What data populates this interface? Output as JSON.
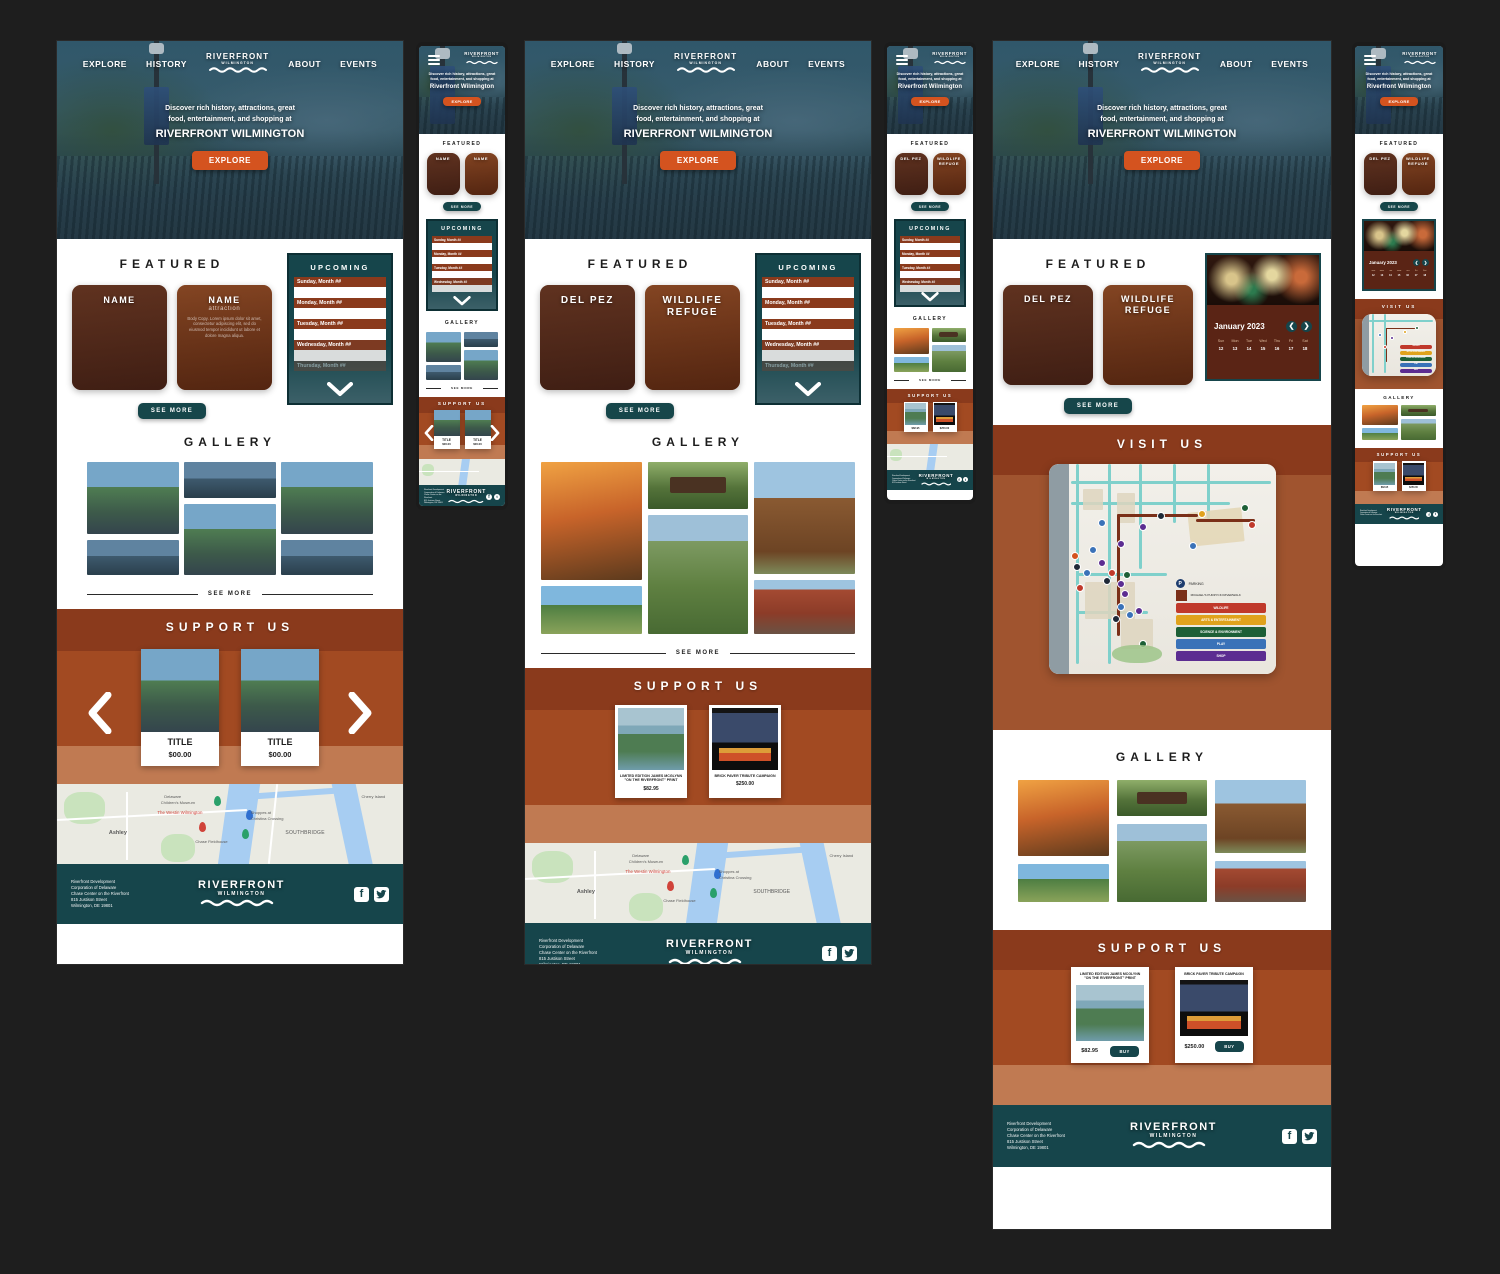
{
  "page": {
    "background": "#1e1e1e",
    "title": "Riverfront Wilmington — Responsive Web Mockups"
  },
  "brand": {
    "name_line1": "RIVERFRONT",
    "name_line2": "WILMINGTON",
    "accent_orange": "#d4531f",
    "accent_teal": "#16454b",
    "accent_rust": "#8a3a1c",
    "accent_clay": "#c07a52"
  },
  "nav": {
    "items": [
      {
        "label": "EXPLORE"
      },
      {
        "label": "HISTORY"
      },
      {
        "label": "ABOUT"
      },
      {
        "label": "EVENTS"
      }
    ],
    "menu_icon": "hamburger-icon"
  },
  "hero": {
    "sub_line1": "Discover rich history, attractions, great",
    "sub_line2": "food, entertainment, and shopping at",
    "headline": "RIVERFRONT WILMINGTON",
    "headline_mobile": "Riverfront Wilmington",
    "cta": "EXPLORE"
  },
  "featured": {
    "title": "FEATURED",
    "see_more": "SEE MORE",
    "placeholder_cards": [
      {
        "name": "NAME",
        "sub": "",
        "text": ""
      },
      {
        "name": "NAME",
        "sub": "attraction",
        "text": "Body Copy. Lorem ipsum dolor sit amet, consectetur adipiscing elit, sed do eiusmod tempor incididunt ut labore et dolore magna aliqua."
      }
    ],
    "real_cards": [
      {
        "name": "DEL PEZ",
        "sub": "",
        "text": ""
      },
      {
        "name": "WILDLIFE REFUGE",
        "sub": "",
        "text": ""
      }
    ]
  },
  "upcoming": {
    "title": "UPCOMING",
    "events": [
      {
        "label": "Sunday, Month ##"
      },
      {
        "label": "Monday, Month ##"
      },
      {
        "label": "Tuesday, Month ##"
      },
      {
        "label": "Wednesday, Month ##"
      },
      {
        "label": "Thursday, Month ##"
      }
    ],
    "scroll_icon": "chevron-down-icon"
  },
  "calendar": {
    "month_label": "January 2023",
    "prev_icon": "chevron-left-icon",
    "next_icon": "chevron-right-icon",
    "day_headers": [
      "Sun",
      "Mon",
      "Tue",
      "Wed",
      "Thu",
      "Fri",
      "Sat"
    ],
    "day_numbers": [
      "12",
      "13",
      "14",
      "15",
      "16",
      "17",
      "18"
    ]
  },
  "gallery": {
    "title": "GALLERY",
    "see_more": "SEE MORE",
    "photos": [
      {
        "caption": "rowers-at-sunset"
      },
      {
        "caption": "wildlife-refuge-sign"
      },
      {
        "caption": "riverwalk-timber-tower"
      },
      {
        "caption": "aerial-riverfront-boardwalk"
      },
      {
        "caption": "marsh-and-skyline"
      },
      {
        "caption": "riverfront-market-building"
      }
    ]
  },
  "visit_us": {
    "title": "VISIT US",
    "legend": [
      {
        "label": "PARKING",
        "color": "#1d3c6e",
        "type": "icon"
      },
      {
        "label": "MICHAEL'S PURZYCKI RIVERWALK",
        "color": "#7a2f18",
        "type": "swatch"
      },
      {
        "label": "WILDLIFE",
        "color": "#c0392b",
        "type": "bar"
      },
      {
        "label": "ARTS & ENTERTAINMENT",
        "color": "#e0a21c",
        "type": "bar"
      },
      {
        "label": "SCIENCE & ENVIRONMENT",
        "color": "#1d5f36",
        "type": "bar"
      },
      {
        "label": "PLAY",
        "color": "#3a72b8",
        "type": "bar"
      },
      {
        "label": "SHOP",
        "color": "#5c2d91",
        "type": "bar"
      }
    ]
  },
  "support": {
    "title": "SUPPORT US",
    "prev_icon": "carousel-prev-arrow",
    "next_icon": "carousel-next-arrow",
    "placeholder_products": [
      {
        "name": "TITLE",
        "price": "$00.00"
      },
      {
        "name": "TITLE",
        "price": "$00.00"
      }
    ],
    "products": [
      {
        "name": "LIMITED EDITION JAMES MCGLYNN \"ON THE RIVERFRONT\" PRINT",
        "price": "$82.95",
        "buy_label": "BUY"
      },
      {
        "name": "BRICK PAVER TRIBUTE CAMPAIGN",
        "price": "$250.00",
        "buy_label": "BUY"
      }
    ]
  },
  "map_strip": {
    "labels": [
      {
        "text": "Delaware",
        "kind": "place"
      },
      {
        "text": "Children's Museum",
        "kind": "place"
      },
      {
        "text": "The Westin Wilmington",
        "kind": "highlight"
      },
      {
        "text": "Shoppes at",
        "kind": "place"
      },
      {
        "text": "Christina Crossing",
        "kind": "place"
      },
      {
        "text": "Ashley",
        "kind": "area"
      },
      {
        "text": "SOUTHBRIDGE",
        "kind": "area"
      },
      {
        "text": "Chase Fieldhouse",
        "kind": "place"
      },
      {
        "text": "Cherry Island",
        "kind": "area"
      }
    ]
  },
  "footer": {
    "address_lines": [
      "Riverfront Development",
      "Corporation of Delaware",
      "Chase Center on the Riverfront",
      "815 Justison Street",
      "Wilmington, DE 19801"
    ],
    "social": [
      {
        "name": "facebook-icon",
        "glyph": "f"
      },
      {
        "name": "twitter-icon",
        "glyph": "✉"
      }
    ]
  }
}
